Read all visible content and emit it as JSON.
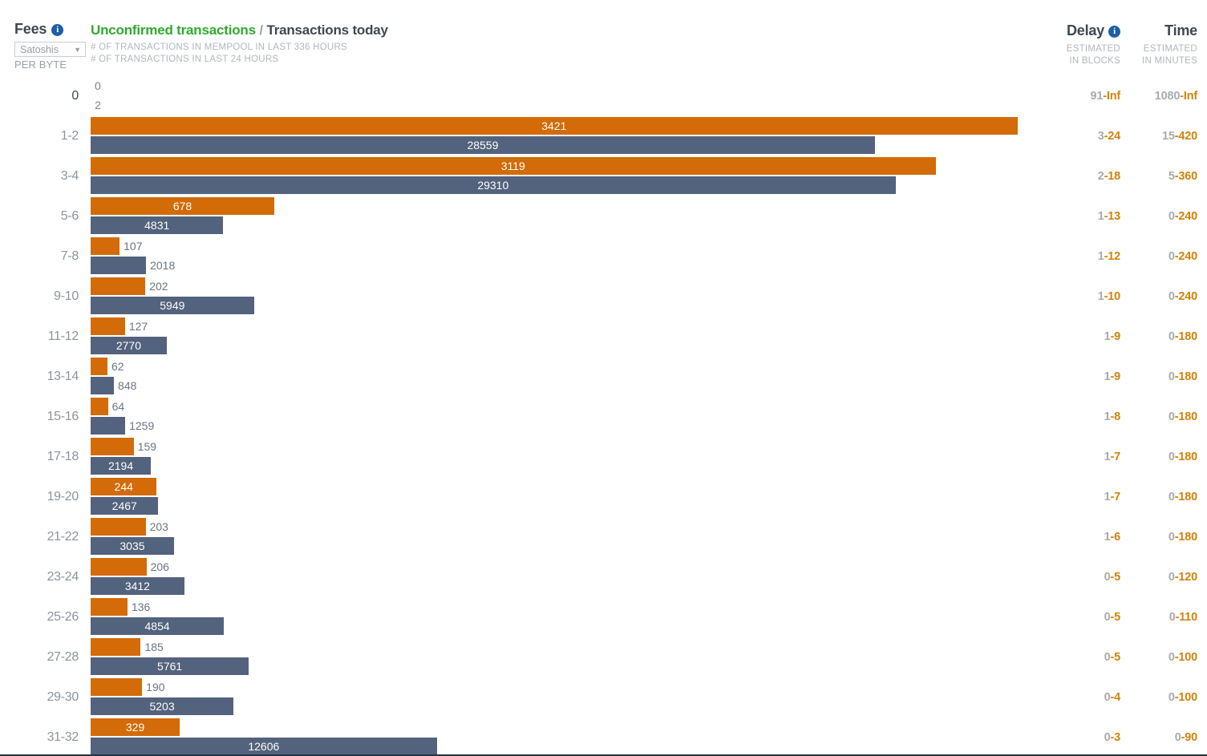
{
  "fees": {
    "title": "Fees",
    "info_icon": "info-icon",
    "unit_value": "Satoshis",
    "unit_caret": "▼",
    "unit_suffix": "PER BYTE"
  },
  "center_header": {
    "title_green": "Unconfirmed transactions",
    "title_separator": "/",
    "title_dark": "Transactions today",
    "sub_line_1": "# OF TRANSACTIONS IN MEMPOOL IN LAST 336 HOURS",
    "sub_line_2": "# OF TRANSACTIONS IN LAST 24 HOURS"
  },
  "delay_header": {
    "title": "Delay",
    "info_icon": "info-icon",
    "sub_line_1": "ESTIMATED",
    "sub_line_2": "IN BLOCKS"
  },
  "time_header": {
    "title": "Time",
    "sub_line_1": "ESTIMATED",
    "sub_line_2": "IN MINUTES"
  },
  "colors": {
    "unconfirmed_bar": "#d26b08",
    "today_bar": "#53627d",
    "accent_green": "#2eab2e",
    "value_high": "#d2820a",
    "value_low": "#a8abae"
  },
  "chart_data": {
    "type": "bar",
    "title": "Unconfirmed transactions / Transactions today",
    "xlabel": "",
    "ylabel": "Fees (Satoshis per byte)",
    "orientation": "horizontal",
    "grid": false,
    "legend": [
      "Unconfirmed transactions",
      "Transactions today"
    ],
    "categories": [
      "0",
      "1-2",
      "3-4",
      "5-6",
      "7-8",
      "9-10",
      "11-12",
      "13-14",
      "15-16",
      "17-18",
      "19-20",
      "21-22",
      "23-24",
      "25-26",
      "27-28",
      "29-30",
      "31-32"
    ],
    "series": [
      {
        "name": "Unconfirmed transactions",
        "color": "#d26b08",
        "values": [
          0,
          3421,
          3119,
          678,
          107,
          202,
          127,
          62,
          64,
          159,
          244,
          203,
          206,
          136,
          185,
          190,
          329
        ]
      },
      {
        "name": "Transactions today",
        "color": "#53627d",
        "values": [
          2,
          28559,
          29310,
          4831,
          2018,
          5949,
          2770,
          848,
          1259,
          2194,
          2467,
          3035,
          3412,
          4854,
          5761,
          5203,
          12606
        ]
      }
    ],
    "delay_blocks": [
      "91-Inf",
      "3-24",
      "2-18",
      "1-13",
      "1-12",
      "1-10",
      "1-9",
      "1-9",
      "1-8",
      "1-7",
      "1-7",
      "1-6",
      "0-5",
      "0-5",
      "0-5",
      "0-4",
      "0-3"
    ],
    "time_minutes": [
      "1080-Inf",
      "15-420",
      "5-360",
      "0-240",
      "0-240",
      "0-240",
      "0-180",
      "0-180",
      "0-180",
      "0-180",
      "0-180",
      "0-180",
      "0-120",
      "0-110",
      "0-100",
      "0-100",
      "0-90"
    ]
  }
}
